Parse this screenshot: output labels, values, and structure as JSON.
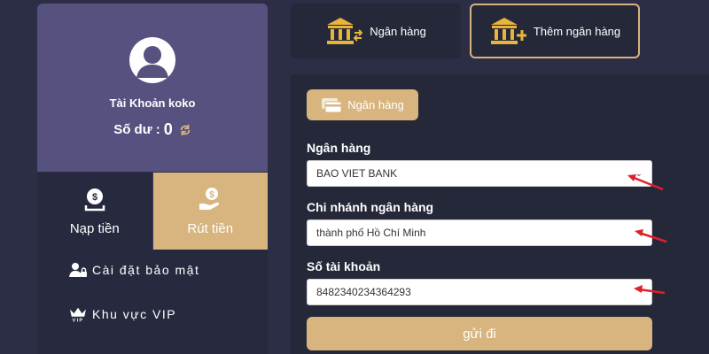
{
  "profile": {
    "account_label": "Tài Khoản koko",
    "balance_label": "Số dư :",
    "balance_value": "0",
    "avatar_icon": "user-avatar-icon",
    "refresh_icon": "refresh-icon"
  },
  "actions": {
    "deposit_label": "Nạp tiền",
    "withdraw_label": "Rút tiền",
    "withdraw_active": true
  },
  "menu": {
    "items": [
      {
        "label": "Cài đặt bảo mật",
        "icon": "user-lock-icon"
      },
      {
        "label": "Khu vực VIP",
        "icon": "vip-crown-icon"
      }
    ]
  },
  "tabs": {
    "bank_label": "Ngân hàng",
    "add_bank_label": "Thêm ngân hàng",
    "active": "add_bank"
  },
  "form": {
    "chip_label": "Ngân hàng",
    "bank_label": "Ngân hàng",
    "bank_value": "BAO VIET BANK",
    "branch_label": "Chi nhánh ngân hàng",
    "branch_value": "thành phố Hồ Chí Minh",
    "account_label": "Số tài khoản",
    "account_value": "8482340234364293",
    "submit_label": "gửi đi"
  },
  "colors": {
    "accent_gold": "#d8b47f",
    "card_purple": "#57517f",
    "panel_dark": "#252839",
    "page_bg": "#2b2e45",
    "annotation_red": "#e0202a"
  }
}
